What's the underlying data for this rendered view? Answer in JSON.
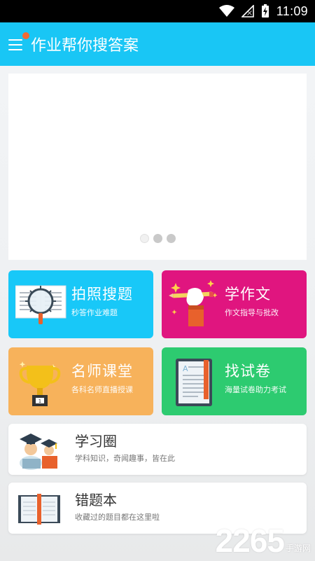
{
  "status_bar": {
    "time": "11:09",
    "icons": [
      "wifi-icon",
      "signal-icon",
      "battery-charging-icon"
    ]
  },
  "app_bar": {
    "title": "作业帮你搜答案",
    "menu_icon": "menu-icon",
    "badge_color": "#f26a32",
    "background": "#19c6f5"
  },
  "banner": {
    "dots": 3,
    "active_index": 0
  },
  "tiles": [
    {
      "title": "拍照搜题",
      "subtitle": "秒答作业难题",
      "icon": "magnifier-book-icon",
      "color": "#18c8f8"
    },
    {
      "title": "学作文",
      "subtitle": "作文指导与批改",
      "icon": "hand-pencil-icon",
      "color": "#e0157f"
    },
    {
      "title": "名师课堂",
      "subtitle": "各科名师直播授课",
      "icon": "trophy-icon",
      "color": "#f7b25b"
    },
    {
      "title": "找试卷",
      "subtitle": "海量试卷助力考试",
      "icon": "exam-tablet-icon",
      "color": "#2dcb70"
    }
  ],
  "cards": [
    {
      "title": "学习圈",
      "subtitle": "学科知识，奇闻趣事，皆在此",
      "icon": "graduates-icon"
    },
    {
      "title": "错题本",
      "subtitle": "收藏过的题目都在这里啦",
      "icon": "open-book-icon"
    }
  ],
  "watermark": {
    "number": "2265",
    "text": "手游网"
  }
}
